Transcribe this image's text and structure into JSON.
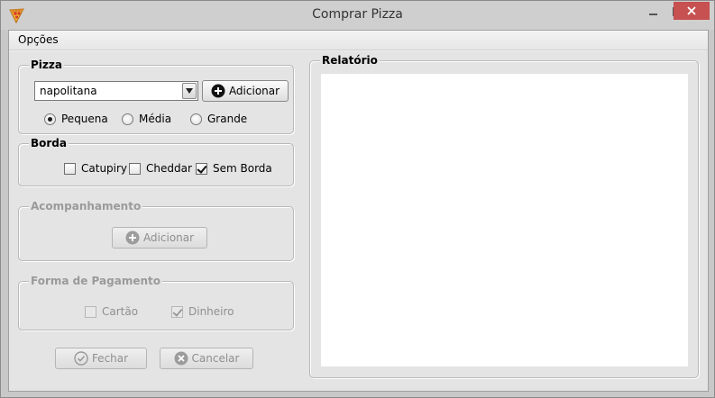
{
  "window": {
    "title": "Comprar Pizza",
    "close_icon": "close-icon",
    "minimize_icon": "minimize-icon",
    "maximize_icon": "maximize-icon"
  },
  "menu": {
    "items": [
      {
        "label": "Opções"
      }
    ]
  },
  "pizza": {
    "title": "Pizza",
    "flavor_selected": "napolitana",
    "add_button": "Adicionar",
    "sizes": [
      {
        "label": "Pequena",
        "selected": true
      },
      {
        "label": "Média",
        "selected": false
      },
      {
        "label": "Grande",
        "selected": false
      }
    ]
  },
  "borda": {
    "title": "Borda",
    "options": [
      {
        "label": "Catupiry",
        "checked": false
      },
      {
        "label": "Cheddar",
        "checked": false
      },
      {
        "label": "Sem Borda",
        "checked": true
      }
    ]
  },
  "acompanhamento": {
    "title": "Acompanhamento",
    "add_button": "Adicionar"
  },
  "pagamento": {
    "title": "Forma de Pagamento",
    "options": [
      {
        "label": "Cartão",
        "checked": false
      },
      {
        "label": "Dinheiro",
        "checked": true
      }
    ]
  },
  "actions": {
    "close_button": "Fechar",
    "cancel_button": "Cancelar"
  },
  "report": {
    "title": "Relatório",
    "content": ""
  },
  "colors": {
    "close_button_bg": "#c75050",
    "disabled_text": "#8f8f8f"
  }
}
